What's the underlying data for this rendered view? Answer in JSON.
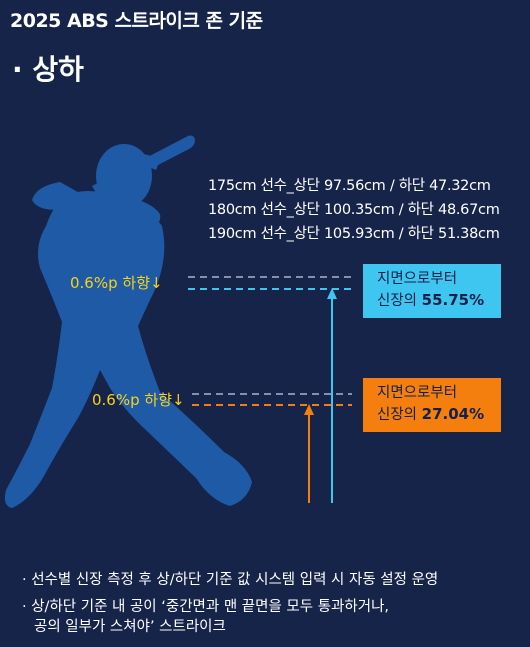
{
  "header": {
    "title": "2025 ABS 스트라이크 존 기준",
    "subtitle": "· 상하"
  },
  "specs": [
    "175cm 선수_상단 97.56cm / 하단 47.32cm",
    "180cm 선수_상단 100.35cm / 하단 48.67cm",
    "190cm 선수_상단 105.93cm / 하단 51.38cm"
  ],
  "adjust": {
    "top": "0.6%p 하향↓",
    "bottom": "0.6%p 하향↓"
  },
  "zone_top": {
    "label": "지면으로부터",
    "prefix": "신장의 ",
    "value": "55.75%",
    "color": "#3fc6f0"
  },
  "zone_bottom": {
    "label": "지면으로부터",
    "prefix": "신장의 ",
    "value": "27.04%",
    "color": "#f57f0e"
  },
  "notes": {
    "line1": "· 선수별 신장 측정 후 상/하단 기준 값 시스템 입력 시 자동 설정 운영",
    "line2a": "· 상/하단 기준 내 공이 ‘중간면과 맨 끝면을 모두 통과하거나,",
    "line2b": "공의 일부가 스쳐야’ 스트라이크"
  },
  "colors": {
    "background": "#172449",
    "silhouette": "#1e5aa6",
    "accent_yellow": "#f7d21c"
  }
}
